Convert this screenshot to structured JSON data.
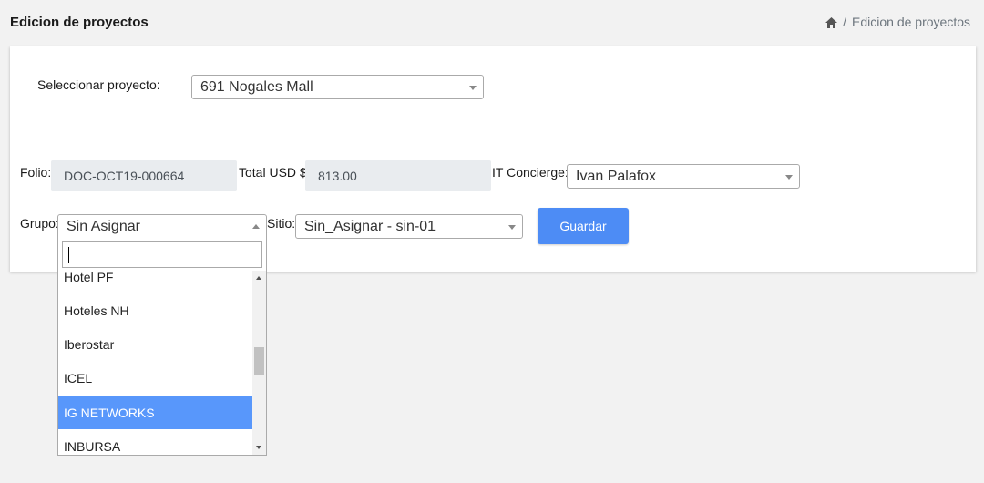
{
  "header": {
    "title": "Edicion de proyectos",
    "breadcrumb": {
      "separator": "/",
      "current": "Edicion de proyectos"
    }
  },
  "form": {
    "project": {
      "label": "Seleccionar proyecto:",
      "value": "691 Nogales Mall"
    },
    "folio": {
      "label": "Folio:",
      "value": "DOC-OCT19-000664"
    },
    "total": {
      "label": "Total USD $",
      "value": "813.00"
    },
    "concierge": {
      "label": "IT Concierge:",
      "value": "Ivan Palafox"
    },
    "grupo": {
      "label": "Grupo:",
      "value": "Sin Asignar"
    },
    "sitio": {
      "label": "Sitio:",
      "value": "Sin_Asignar - sin-01"
    },
    "save_label": "Guardar"
  },
  "dropdown": {
    "search_value": "",
    "items": [
      "Hotel PF",
      "Hoteles NH",
      "Iberostar",
      "ICEL",
      "IG NETWORKS",
      "INBURSA"
    ],
    "highlighted": "IG NETWORKS"
  },
  "colors": {
    "accent": "#4d8cf5",
    "highlight": "#5897fb",
    "readonly_bg": "#e9ecef"
  }
}
